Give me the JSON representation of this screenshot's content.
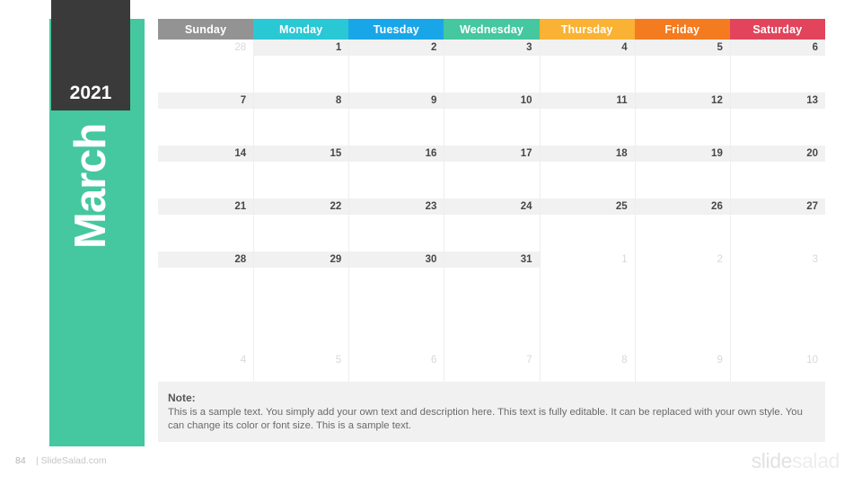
{
  "sidebar": {
    "year": "2021",
    "month": "March",
    "green_color": "#45c79f",
    "dark_color": "#3a3a3a"
  },
  "calendar": {
    "weekdays": [
      {
        "label": "Sunday",
        "color": "#939393"
      },
      {
        "label": "Monday",
        "color": "#2ac7d4"
      },
      {
        "label": "Tuesday",
        "color": "#19a6e8"
      },
      {
        "label": "Wednesday",
        "color": "#45c79f"
      },
      {
        "label": "Thursday",
        "color": "#f9b233"
      },
      {
        "label": "Friday",
        "color": "#f47b20"
      },
      {
        "label": "Saturday",
        "color": "#e2445c"
      }
    ],
    "weeks": [
      {
        "days": [
          {
            "num": "28",
            "muted": true
          },
          {
            "num": "1",
            "muted": false
          },
          {
            "num": "2",
            "muted": false
          },
          {
            "num": "3",
            "muted": false
          },
          {
            "num": "4",
            "muted": false
          },
          {
            "num": "5",
            "muted": false
          },
          {
            "num": "6",
            "muted": false
          }
        ],
        "band_start": 1,
        "band_end": 7
      },
      {
        "days": [
          {
            "num": "7",
            "muted": false
          },
          {
            "num": "8",
            "muted": false
          },
          {
            "num": "9",
            "muted": false
          },
          {
            "num": "10",
            "muted": false
          },
          {
            "num": "11",
            "muted": false
          },
          {
            "num": "12",
            "muted": false
          },
          {
            "num": "13",
            "muted": false
          }
        ],
        "band_start": 0,
        "band_end": 7
      },
      {
        "days": [
          {
            "num": "14",
            "muted": false
          },
          {
            "num": "15",
            "muted": false
          },
          {
            "num": "16",
            "muted": false
          },
          {
            "num": "17",
            "muted": false
          },
          {
            "num": "18",
            "muted": false
          },
          {
            "num": "19",
            "muted": false
          },
          {
            "num": "20",
            "muted": false
          }
        ],
        "band_start": 0,
        "band_end": 7
      },
      {
        "days": [
          {
            "num": "21",
            "muted": false
          },
          {
            "num": "22",
            "muted": false
          },
          {
            "num": "23",
            "muted": false
          },
          {
            "num": "24",
            "muted": false
          },
          {
            "num": "25",
            "muted": false
          },
          {
            "num": "26",
            "muted": false
          },
          {
            "num": "27",
            "muted": false
          }
        ],
        "band_start": 0,
        "band_end": 7
      },
      {
        "days": [
          {
            "num": "28",
            "muted": false
          },
          {
            "num": "29",
            "muted": false
          },
          {
            "num": "30",
            "muted": false
          },
          {
            "num": "31",
            "muted": false
          },
          {
            "num": "1",
            "muted": true
          },
          {
            "num": "2",
            "muted": true
          },
          {
            "num": "3",
            "muted": true
          }
        ],
        "band_start": 0,
        "band_end": 4
      },
      {
        "days": [
          {
            "num": "4",
            "muted": true
          },
          {
            "num": "5",
            "muted": true
          },
          {
            "num": "6",
            "muted": true
          },
          {
            "num": "7",
            "muted": true
          },
          {
            "num": "8",
            "muted": true
          },
          {
            "num": "9",
            "muted": true
          },
          {
            "num": "10",
            "muted": true
          }
        ],
        "band_start": 0,
        "band_end": 0
      }
    ]
  },
  "note": {
    "title": "Note:",
    "body": "This is a sample text. You simply add your own text and description here. This text is fully editable. It can be replaced with your own style. You can change its color or font size. This is a sample text."
  },
  "footer": {
    "page_number": "84",
    "site": "| SlideSalad.com",
    "logo_part1": "slide",
    "logo_part2": "salad"
  }
}
